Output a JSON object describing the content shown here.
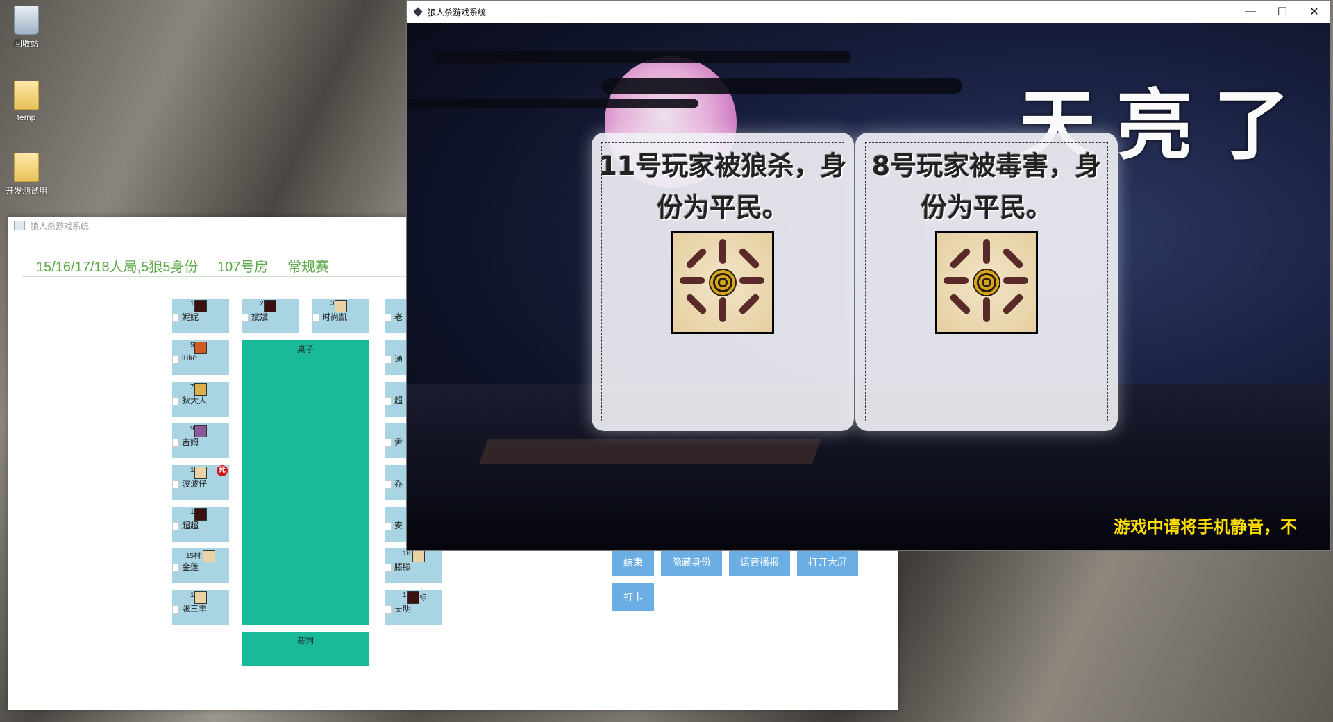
{
  "desktop": {
    "icons": [
      {
        "label": "回收站",
        "icon": "recycle-bin-icon"
      },
      {
        "label": "temp",
        "icon": "folder-icon"
      },
      {
        "label": "开发测试用",
        "icon": "folder-icon"
      }
    ]
  },
  "back_window": {
    "title": "狼人杀游戏系统",
    "info": {
      "format": "15/16/17/18人局,5狼5身份",
      "room": "107号房",
      "mode": "常规赛"
    },
    "seats_left": [
      {
        "num": "1",
        "name": "妮妮",
        "role_icon": "wolf"
      },
      {
        "num": "5",
        "name": "luke",
        "role_icon": "fire"
      },
      {
        "num": "7",
        "name": "狄大人",
        "role_icon": "eye"
      },
      {
        "num": "9",
        "name": "吉姆",
        "role_icon": "witch"
      },
      {
        "num": "11",
        "name": "波波仔",
        "role_icon": "villager",
        "dead_badge": "死"
      },
      {
        "num": "13",
        "name": "超超",
        "role_icon": "wolf"
      },
      {
        "num": "15",
        "name": "金莲",
        "role_icon": "villager",
        "tag": "村"
      },
      {
        "num": "17",
        "name": "张三丰",
        "role_icon": "villager"
      }
    ],
    "seats_top": [
      {
        "num": "2",
        "name": "斌斌",
        "role_icon": "wolf"
      },
      {
        "num": "3",
        "name": "时尚凯",
        "role_icon": "villager"
      }
    ],
    "seats_right": [
      {
        "name": "老"
      },
      {
        "name": "通"
      },
      {
        "name": "超"
      },
      {
        "name": "尹"
      },
      {
        "name": "乔"
      },
      {
        "name": "安"
      },
      {
        "num": "16",
        "name": "滕滕",
        "role_icon": "villager"
      },
      {
        "num": "18",
        "name": "吴明",
        "role_icon": "wolf",
        "tag": "标"
      }
    ],
    "table_label": "桌子",
    "judge_label": "裁判",
    "buttons": {
      "end": "结束",
      "hide_identity": "隐藏身份",
      "voice": "语音播报",
      "big_screen": "打开大屏",
      "checkin": "打卡"
    }
  },
  "front_window": {
    "title": "狼人杀游戏系统",
    "controls": {
      "minimize": "—",
      "maximize": "☐",
      "close": "✕"
    },
    "headline": "天亮了",
    "cards": [
      {
        "message": "11号玩家被狼杀，身份为平民。"
      },
      {
        "message": "8号玩家被毒害，身份为平民。"
      }
    ],
    "ticker": "游戏中请将手机静音，不"
  }
}
